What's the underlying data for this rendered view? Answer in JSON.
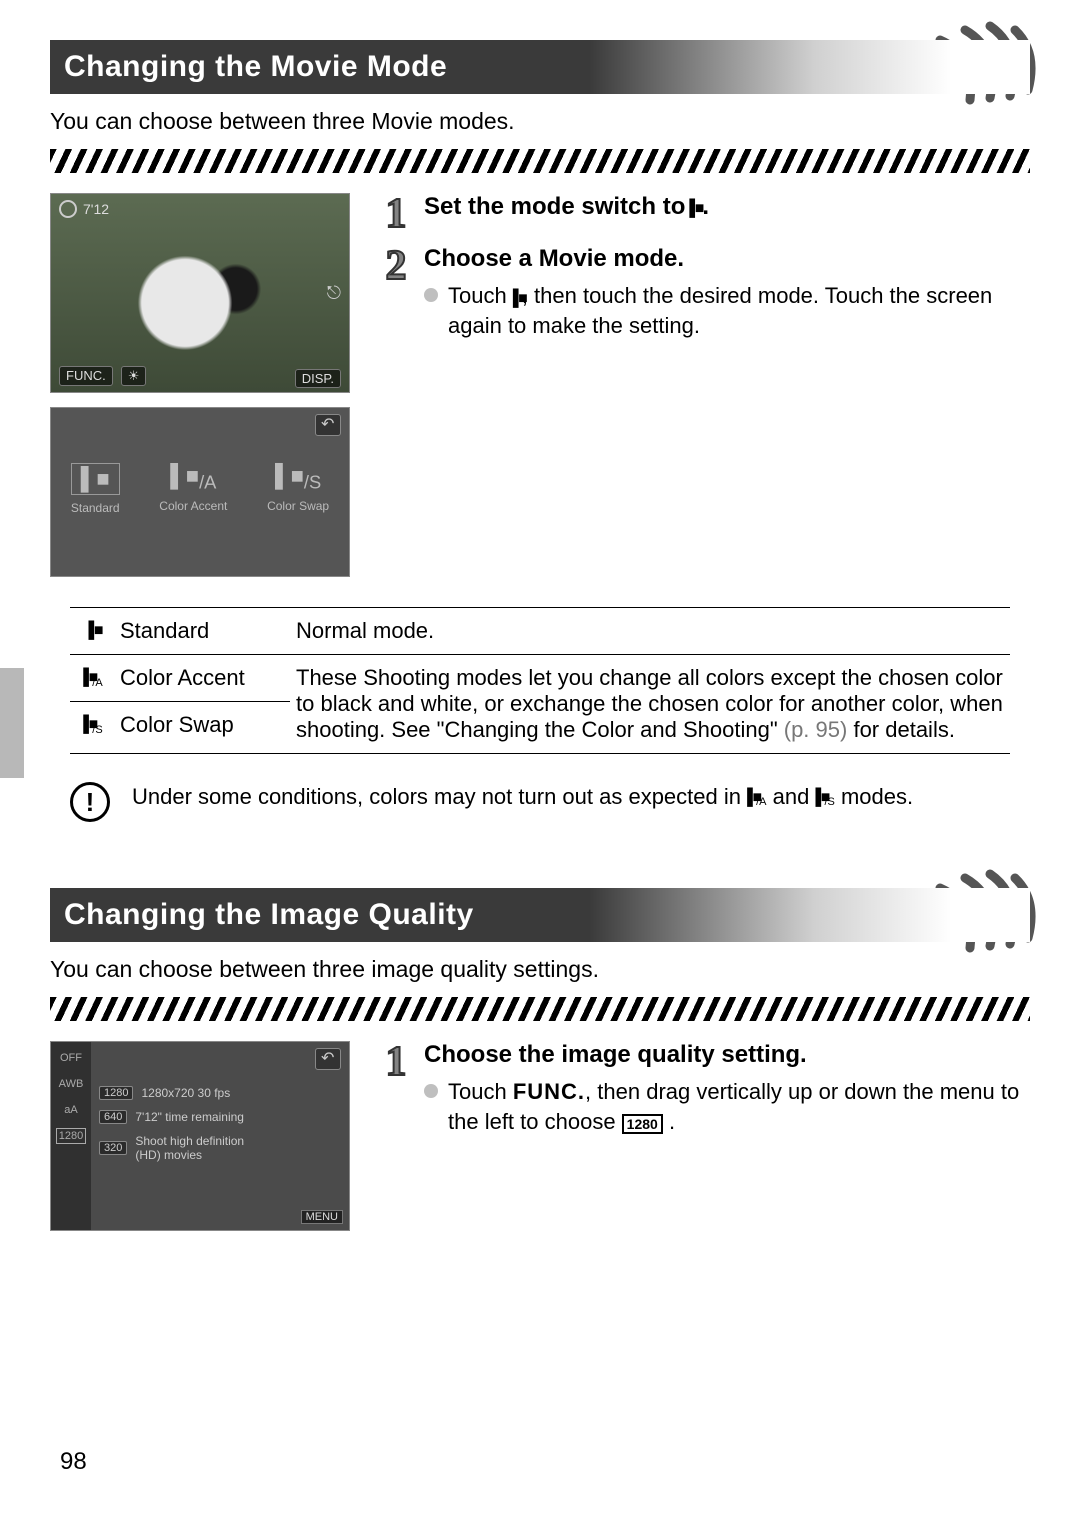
{
  "page_number": "98",
  "section1": {
    "title": "Changing the Movie Mode",
    "intro": "You can choose between three Movie modes.",
    "step1_title_pre": "Set the mode switch to ",
    "step1_title_post": ".",
    "step2_title": "Choose a Movie mode.",
    "step2_text_1": "Touch ",
    "step2_text_2": ", then touch the desired mode. Touch the screen again to make the setting.",
    "shot1": {
      "top_left": "7'12",
      "bl_func": "FUNC.",
      "bl_ev": "☀",
      "br": "DISP.",
      "mr": "⎋"
    },
    "shot2": {
      "m1": "Standard",
      "m2": "Color Accent",
      "m3": "Color Swap"
    }
  },
  "mode_table": {
    "r1_name": "Standard",
    "r1_desc": "Normal mode.",
    "r2_name": "Color Accent",
    "r3_name": "Color Swap",
    "r23_desc_1": "These Shooting modes let you change all colors except the chosen color to black and white, or exchange the chosen color for another color, when shooting. See \"Changing the Color and Shooting\" ",
    "r23_xref": "(p. 95)",
    "r23_desc_2": " for details."
  },
  "caution": {
    "text_1": "Under some conditions, colors may not turn out as expected in ",
    "text_2": " and ",
    "text_3": " modes."
  },
  "section2": {
    "title": "Changing the Image Quality",
    "intro": "You can choose between three image quality settings.",
    "step1_title": "Choose the image quality setting.",
    "step1_text_1": "Touch ",
    "step1_func": "FUNC.",
    "step1_text_2": ", then drag vertically up or down the menu to the left to choose ",
    "step1_res": "1280",
    "step1_text_3": " .",
    "shot3": {
      "res_line": "1280x720 30 fps",
      "time_line": "7'12\" time remaining",
      "desc_line1": "Shoot high definition",
      "desc_line2": "(HD) movies",
      "menu": "MENU",
      "left": {
        "a": "OFF",
        "b": "AWB",
        "c": "aA",
        "d": "1280"
      },
      "chips": {
        "a": "1280",
        "b": "640",
        "c": "320"
      }
    }
  }
}
